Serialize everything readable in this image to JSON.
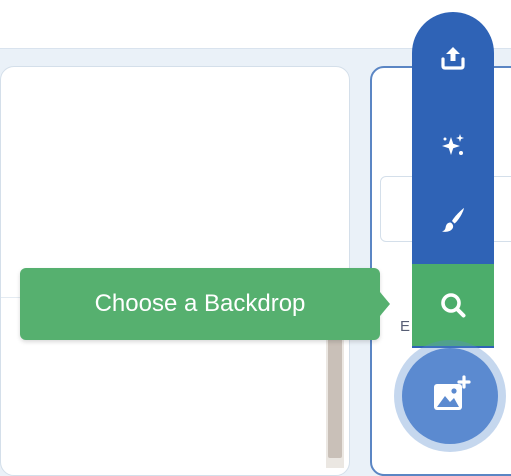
{
  "tooltip": {
    "label": "Choose a Backdrop"
  },
  "stage_panel": {
    "partial_label": "E        s"
  },
  "backdrop_menu": {
    "items": [
      {
        "name": "upload-icon",
        "action": "Upload Backdrop"
      },
      {
        "name": "surprise-icon",
        "action": "Surprise"
      },
      {
        "name": "paint-icon",
        "action": "Paint"
      },
      {
        "name": "search-icon",
        "action": "Choose a Backdrop"
      }
    ],
    "fab_icon": "add-backdrop-icon"
  },
  "colors": {
    "menu_blue": "#2f63b6",
    "highlight_green": "#4cad6b",
    "tooltip_green": "#56b06f",
    "fab_blue": "#5b8ad0"
  }
}
